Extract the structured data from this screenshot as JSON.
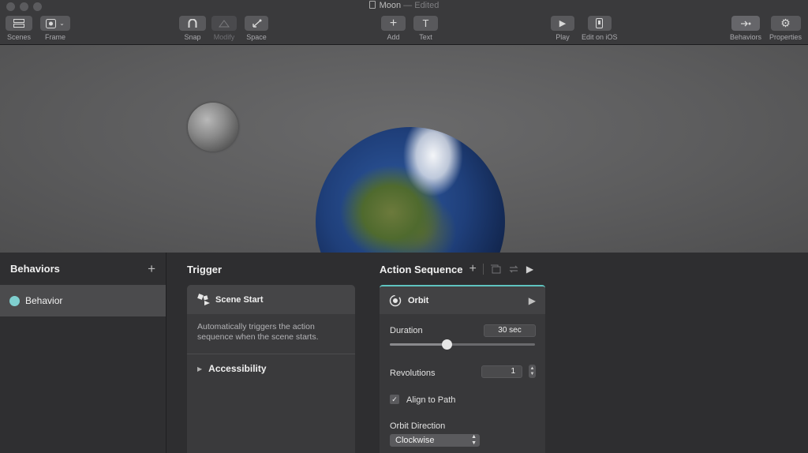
{
  "window": {
    "title": "Moon",
    "status": "— Edited"
  },
  "toolbar": {
    "scenes": "Scenes",
    "frame": "Frame",
    "snap": "Snap",
    "modify": "Modify",
    "space": "Space",
    "add": "Add",
    "text": "Text",
    "play": "Play",
    "edit_ios": "Edit on iOS",
    "behaviors": "Behaviors",
    "properties": "Properties"
  },
  "behaviors_panel": {
    "title": "Behaviors",
    "items": [
      {
        "label": "Behavior",
        "color": "#7fcfcf"
      }
    ]
  },
  "trigger": {
    "section_title": "Trigger",
    "name": "Scene Start",
    "description": "Automatically triggers the action sequence when the scene starts.",
    "accessibility": "Accessibility"
  },
  "action_sequence": {
    "section_title": "Action Sequence",
    "accent_color": "#5fc4c0",
    "action": {
      "name": "Orbit",
      "duration_label": "Duration",
      "duration_value": "30 sec",
      "duration_slider_fraction": 0.39,
      "revolutions_label": "Revolutions",
      "revolutions_value": "1",
      "align_label": "Align to Path",
      "align_checked": true,
      "direction_label": "Orbit Direction",
      "direction_value": "Clockwise"
    }
  }
}
